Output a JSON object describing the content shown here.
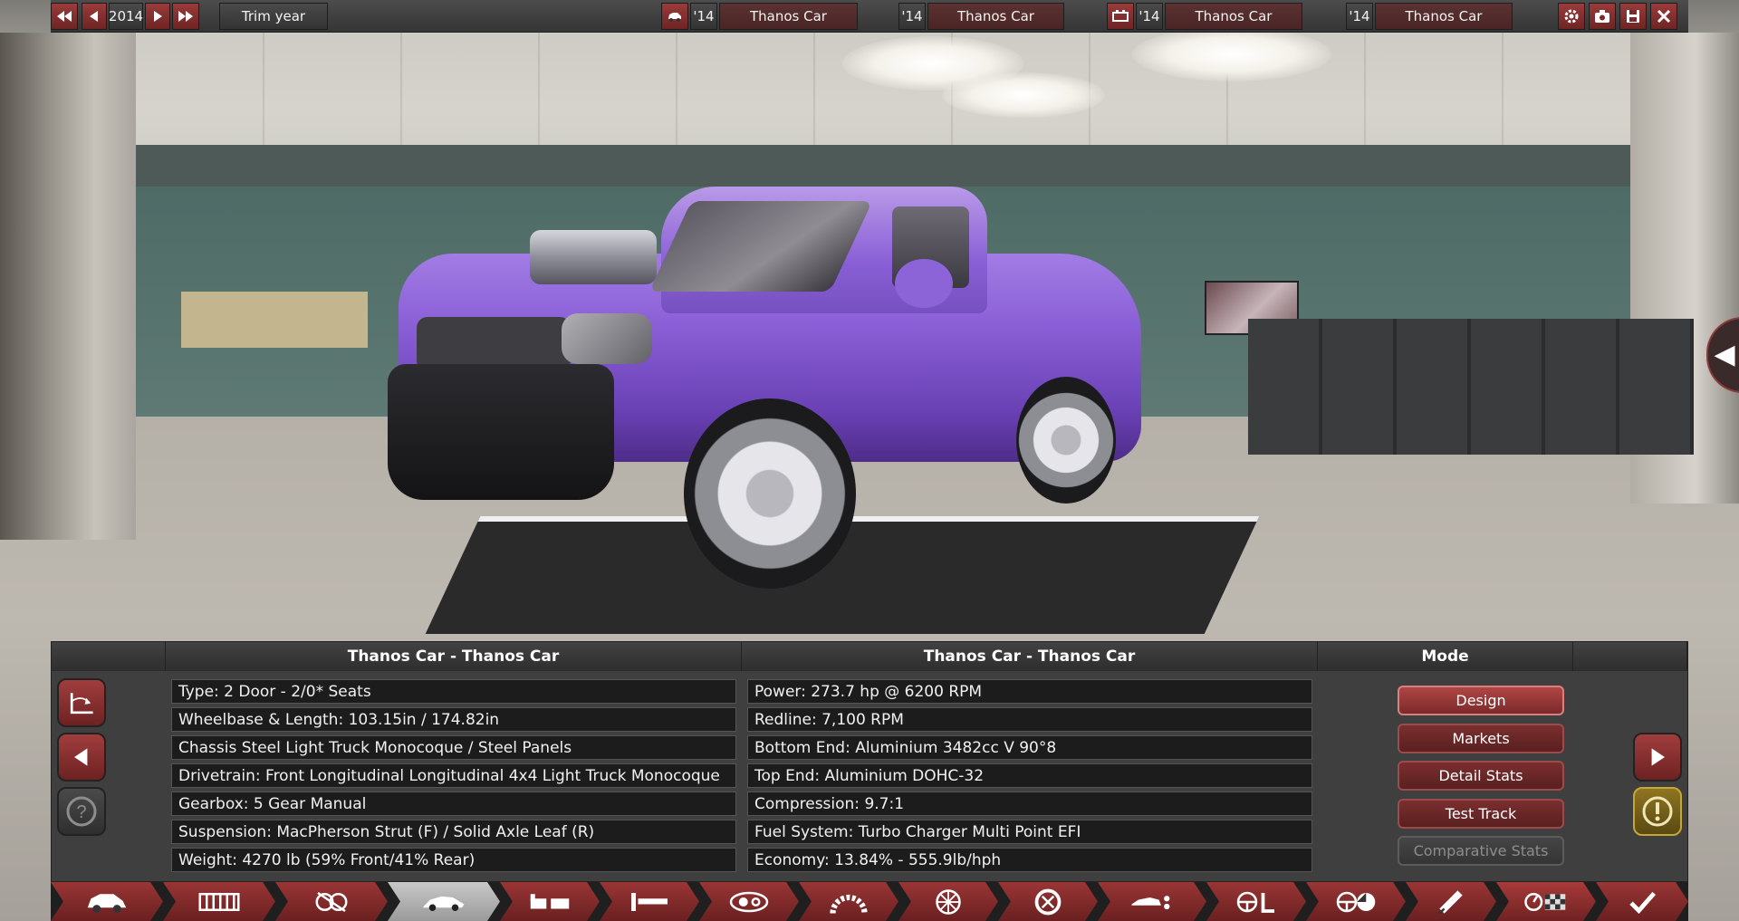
{
  "topbar": {
    "year": "2014",
    "trim_year_label": "Trim year",
    "groups": [
      {
        "icon": "car-icon",
        "year": "'14",
        "name": "Thanos Car"
      },
      {
        "icon": "",
        "year": "'14",
        "name": "Thanos Car"
      },
      {
        "icon": "engine-block-icon",
        "year": "'14",
        "name": "Thanos Car"
      },
      {
        "icon": "",
        "year": "'14",
        "name": "Thanos Car"
      }
    ],
    "right_icons": [
      "gear-icon",
      "camera-icon",
      "save-icon",
      "close-icon"
    ]
  },
  "panel": {
    "left_header": "Thanos Car - Thanos Car",
    "right_header": "Thanos Car - Thanos Car",
    "mode_header": "Mode",
    "body_stats": [
      "Type: 2 Door - 2/0* Seats",
      "Wheelbase & Length: 103.15in / 174.82in",
      "Chassis Steel Light Truck Monocoque / Steel Panels",
      "Drivetrain: Front Longitudinal Longitudinal 4x4 Light Truck Monocoque",
      "Gearbox: 5 Gear Manual",
      "Suspension: MacPherson Strut (F) / Solid Axle Leaf (R)",
      "Weight: 4270 lb (59% Front/41% Rear)"
    ],
    "engine_stats": [
      "Power: 273.7 hp @ 6200 RPM",
      "Redline:  7,100 RPM",
      "Bottom End: Aluminium 3482cc V 90°8",
      "Top End: Aluminium DOHC-32",
      "Compression: 9.7:1",
      "Fuel System: Turbo Charger Multi Point EFI",
      "Economy: 13.84% - 555.9lb/hph"
    ],
    "modes": [
      {
        "label": "Design",
        "state": "active"
      },
      {
        "label": "Markets",
        "state": "normal"
      },
      {
        "label": "Detail Stats",
        "state": "normal"
      },
      {
        "label": "Test Track",
        "state": "normal"
      },
      {
        "label": "Comparative Stats",
        "state": "disabled"
      }
    ]
  },
  "navbar": {
    "tabs": [
      "car-icon",
      "chassis-icon",
      "suspension-icon",
      "body-icon",
      "interior-icon",
      "fixtures-icon",
      "lights-icon",
      "gearbox-icon",
      "wheel-icon",
      "tire-icon",
      "aero-icon",
      "steering-icon",
      "brake-icon",
      "exhaust-icon",
      "timer-checkered-icon",
      "check-icon"
    ],
    "selected_index": 3
  },
  "colors": {
    "accent_red": "#9a3535",
    "truck_purple": "#8a5fd6"
  }
}
